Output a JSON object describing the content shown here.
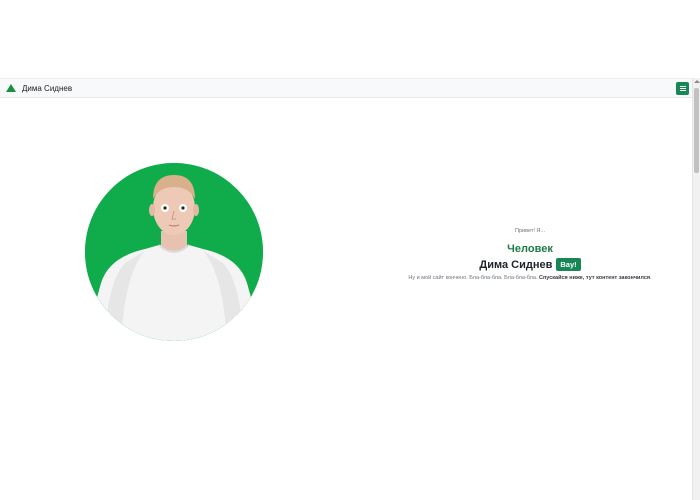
{
  "navbar": {
    "brand_name": "Дима Сиднев",
    "brand_icon": "triangle-logo-icon",
    "menu_icon": "hamburger-icon"
  },
  "hero": {
    "photo_alt": "Дима Сиднев",
    "greeting": "Привет! Я...",
    "role": "Человек",
    "name": "Дима Сиднев",
    "badge": "Вау!",
    "lead_plain": "Ну и мой сайт кончено. Бла-бла-бла. Бла-бла-бла.",
    "lead_bold": "Спускайся ниже, тут контент закончился",
    "lead_end": "."
  },
  "colors": {
    "accent": "#198754",
    "photo_background": "#10ac4b",
    "navbar_background": "#f8f9fa"
  }
}
